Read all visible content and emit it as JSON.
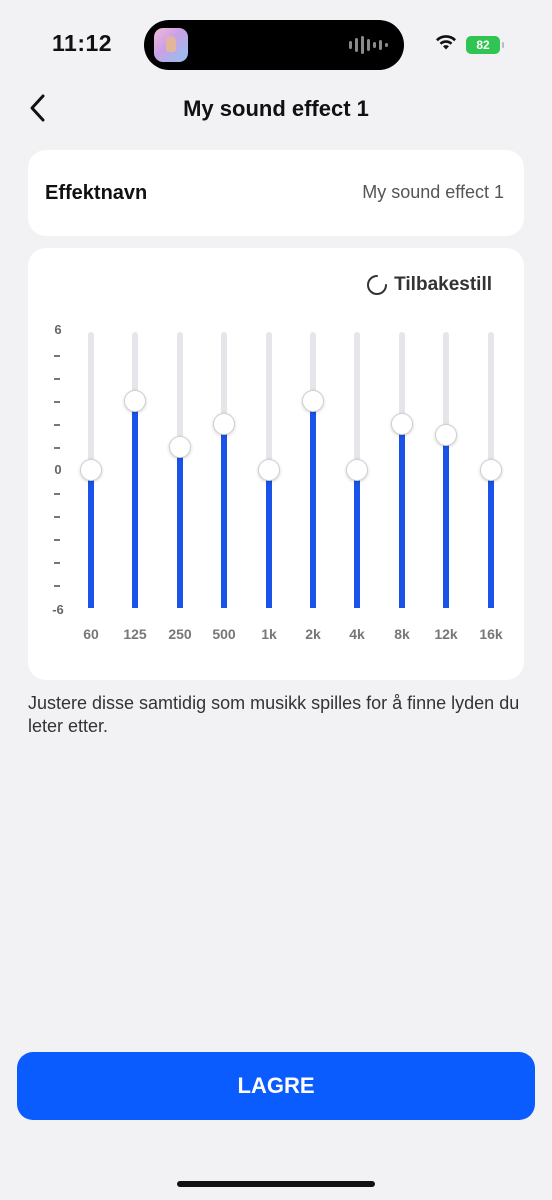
{
  "status_bar": {
    "time": "11:12",
    "battery": "82"
  },
  "header": {
    "title": "My sound effect 1",
    "back_icon": "chevron-left-icon"
  },
  "effect_name": {
    "label": "Effektnavn",
    "value": "My sound effect 1"
  },
  "equalizer": {
    "reset_label": "Tilbakestill",
    "y_axis": {
      "top": "6",
      "mid": "0",
      "bottom": "-6",
      "range": [
        -6,
        6
      ]
    },
    "bands": [
      {
        "label": "60",
        "value": 0
      },
      {
        "label": "125",
        "value": 3
      },
      {
        "label": "250",
        "value": 1
      },
      {
        "label": "500",
        "value": 2
      },
      {
        "label": "1k",
        "value": 0
      },
      {
        "label": "2k",
        "value": 3
      },
      {
        "label": "4k",
        "value": 0
      },
      {
        "label": "8k",
        "value": 2
      },
      {
        "label": "12k",
        "value": 1.5
      },
      {
        "label": "16k",
        "value": 0
      }
    ],
    "fill_color": "#1a53e8"
  },
  "help_text": "Justere disse samtidig som musikk spilles for å finne lyden du leter etter.",
  "save_label": "LAGRE",
  "accent_color": "#0a5cff"
}
